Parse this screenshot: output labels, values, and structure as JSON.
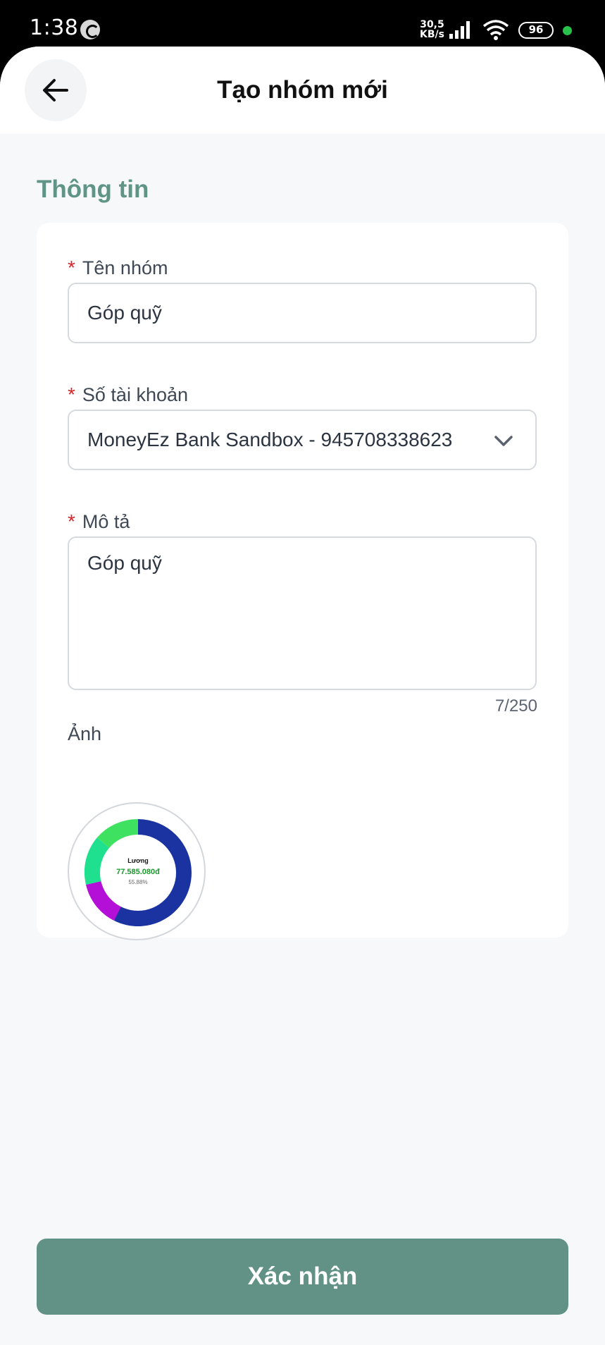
{
  "status_bar": {
    "time": "1:38",
    "speed_value": "30,5",
    "speed_unit": "KB/s",
    "battery": "96",
    "indicator_color": "#27c24c"
  },
  "header": {
    "title": "Tạo nhóm mới",
    "back_icon": "arrow-left-icon"
  },
  "section": {
    "title": "Thông tin"
  },
  "form": {
    "required_mark": "*",
    "group_name": {
      "label": "Tên nhóm",
      "value": "Góp quỹ"
    },
    "account": {
      "label": "Số tài khoản",
      "value": "MoneyEz Bank Sandbox - 945708338623",
      "icon": "chevron-down-icon"
    },
    "description": {
      "label": "Mô tả",
      "value": "Góp quỹ",
      "counter": "7/250"
    },
    "image": {
      "label": "Ảnh",
      "donut_title": "Lương",
      "donut_amount": "77.585.080đ",
      "donut_percent": "55.88%"
    }
  },
  "confirm_button": {
    "label": "Xác nhận"
  },
  "colors": {
    "accent": "#5f9486",
    "button": "#629285",
    "required": "#d9262c"
  }
}
